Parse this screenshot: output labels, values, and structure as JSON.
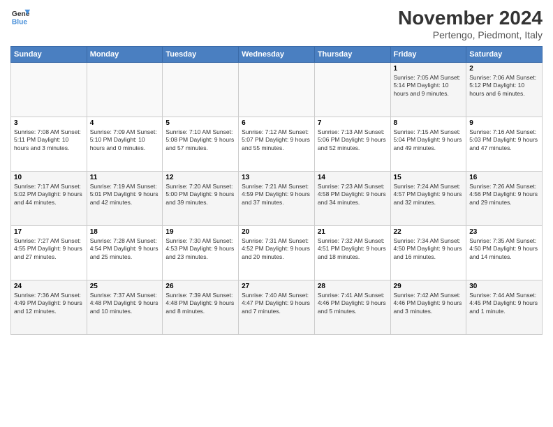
{
  "logo": {
    "line1": "General",
    "line2": "Blue"
  },
  "title": "November 2024",
  "subtitle": "Pertengo, Piedmont, Italy",
  "headers": [
    "Sunday",
    "Monday",
    "Tuesday",
    "Wednesday",
    "Thursday",
    "Friday",
    "Saturday"
  ],
  "weeks": [
    [
      {
        "day": "",
        "info": ""
      },
      {
        "day": "",
        "info": ""
      },
      {
        "day": "",
        "info": ""
      },
      {
        "day": "",
        "info": ""
      },
      {
        "day": "",
        "info": ""
      },
      {
        "day": "1",
        "info": "Sunrise: 7:05 AM\nSunset: 5:14 PM\nDaylight: 10 hours\nand 9 minutes."
      },
      {
        "day": "2",
        "info": "Sunrise: 7:06 AM\nSunset: 5:12 PM\nDaylight: 10 hours\nand 6 minutes."
      }
    ],
    [
      {
        "day": "3",
        "info": "Sunrise: 7:08 AM\nSunset: 5:11 PM\nDaylight: 10 hours\nand 3 minutes."
      },
      {
        "day": "4",
        "info": "Sunrise: 7:09 AM\nSunset: 5:10 PM\nDaylight: 10 hours\nand 0 minutes."
      },
      {
        "day": "5",
        "info": "Sunrise: 7:10 AM\nSunset: 5:08 PM\nDaylight: 9 hours\nand 57 minutes."
      },
      {
        "day": "6",
        "info": "Sunrise: 7:12 AM\nSunset: 5:07 PM\nDaylight: 9 hours\nand 55 minutes."
      },
      {
        "day": "7",
        "info": "Sunrise: 7:13 AM\nSunset: 5:06 PM\nDaylight: 9 hours\nand 52 minutes."
      },
      {
        "day": "8",
        "info": "Sunrise: 7:15 AM\nSunset: 5:04 PM\nDaylight: 9 hours\nand 49 minutes."
      },
      {
        "day": "9",
        "info": "Sunrise: 7:16 AM\nSunset: 5:03 PM\nDaylight: 9 hours\nand 47 minutes."
      }
    ],
    [
      {
        "day": "10",
        "info": "Sunrise: 7:17 AM\nSunset: 5:02 PM\nDaylight: 9 hours\nand 44 minutes."
      },
      {
        "day": "11",
        "info": "Sunrise: 7:19 AM\nSunset: 5:01 PM\nDaylight: 9 hours\nand 42 minutes."
      },
      {
        "day": "12",
        "info": "Sunrise: 7:20 AM\nSunset: 5:00 PM\nDaylight: 9 hours\nand 39 minutes."
      },
      {
        "day": "13",
        "info": "Sunrise: 7:21 AM\nSunset: 4:59 PM\nDaylight: 9 hours\nand 37 minutes."
      },
      {
        "day": "14",
        "info": "Sunrise: 7:23 AM\nSunset: 4:58 PM\nDaylight: 9 hours\nand 34 minutes."
      },
      {
        "day": "15",
        "info": "Sunrise: 7:24 AM\nSunset: 4:57 PM\nDaylight: 9 hours\nand 32 minutes."
      },
      {
        "day": "16",
        "info": "Sunrise: 7:26 AM\nSunset: 4:56 PM\nDaylight: 9 hours\nand 29 minutes."
      }
    ],
    [
      {
        "day": "17",
        "info": "Sunrise: 7:27 AM\nSunset: 4:55 PM\nDaylight: 9 hours\nand 27 minutes."
      },
      {
        "day": "18",
        "info": "Sunrise: 7:28 AM\nSunset: 4:54 PM\nDaylight: 9 hours\nand 25 minutes."
      },
      {
        "day": "19",
        "info": "Sunrise: 7:30 AM\nSunset: 4:53 PM\nDaylight: 9 hours\nand 23 minutes."
      },
      {
        "day": "20",
        "info": "Sunrise: 7:31 AM\nSunset: 4:52 PM\nDaylight: 9 hours\nand 20 minutes."
      },
      {
        "day": "21",
        "info": "Sunrise: 7:32 AM\nSunset: 4:51 PM\nDaylight: 9 hours\nand 18 minutes."
      },
      {
        "day": "22",
        "info": "Sunrise: 7:34 AM\nSunset: 4:50 PM\nDaylight: 9 hours\nand 16 minutes."
      },
      {
        "day": "23",
        "info": "Sunrise: 7:35 AM\nSunset: 4:50 PM\nDaylight: 9 hours\nand 14 minutes."
      }
    ],
    [
      {
        "day": "24",
        "info": "Sunrise: 7:36 AM\nSunset: 4:49 PM\nDaylight: 9 hours\nand 12 minutes."
      },
      {
        "day": "25",
        "info": "Sunrise: 7:37 AM\nSunset: 4:48 PM\nDaylight: 9 hours\nand 10 minutes."
      },
      {
        "day": "26",
        "info": "Sunrise: 7:39 AM\nSunset: 4:48 PM\nDaylight: 9 hours\nand 8 minutes."
      },
      {
        "day": "27",
        "info": "Sunrise: 7:40 AM\nSunset: 4:47 PM\nDaylight: 9 hours\nand 7 minutes."
      },
      {
        "day": "28",
        "info": "Sunrise: 7:41 AM\nSunset: 4:46 PM\nDaylight: 9 hours\nand 5 minutes."
      },
      {
        "day": "29",
        "info": "Sunrise: 7:42 AM\nSunset: 4:46 PM\nDaylight: 9 hours\nand 3 minutes."
      },
      {
        "day": "30",
        "info": "Sunrise: 7:44 AM\nSunset: 4:45 PM\nDaylight: 9 hours\nand 1 minute."
      }
    ]
  ]
}
